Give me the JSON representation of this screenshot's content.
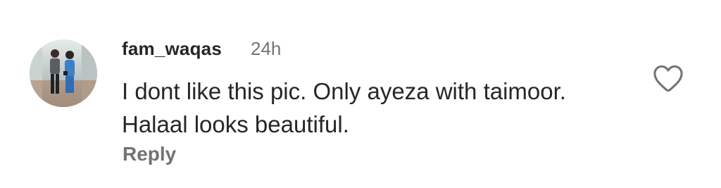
{
  "comment": {
    "username": "fam_waqas",
    "time_ago": "24h",
    "text": "I dont like this pic. Only ayeza with taimoor. Halaal looks beautiful.",
    "reply_label": "Reply",
    "avatar_icon": "profile-photo",
    "like_icon": "heart-outline-icon"
  }
}
